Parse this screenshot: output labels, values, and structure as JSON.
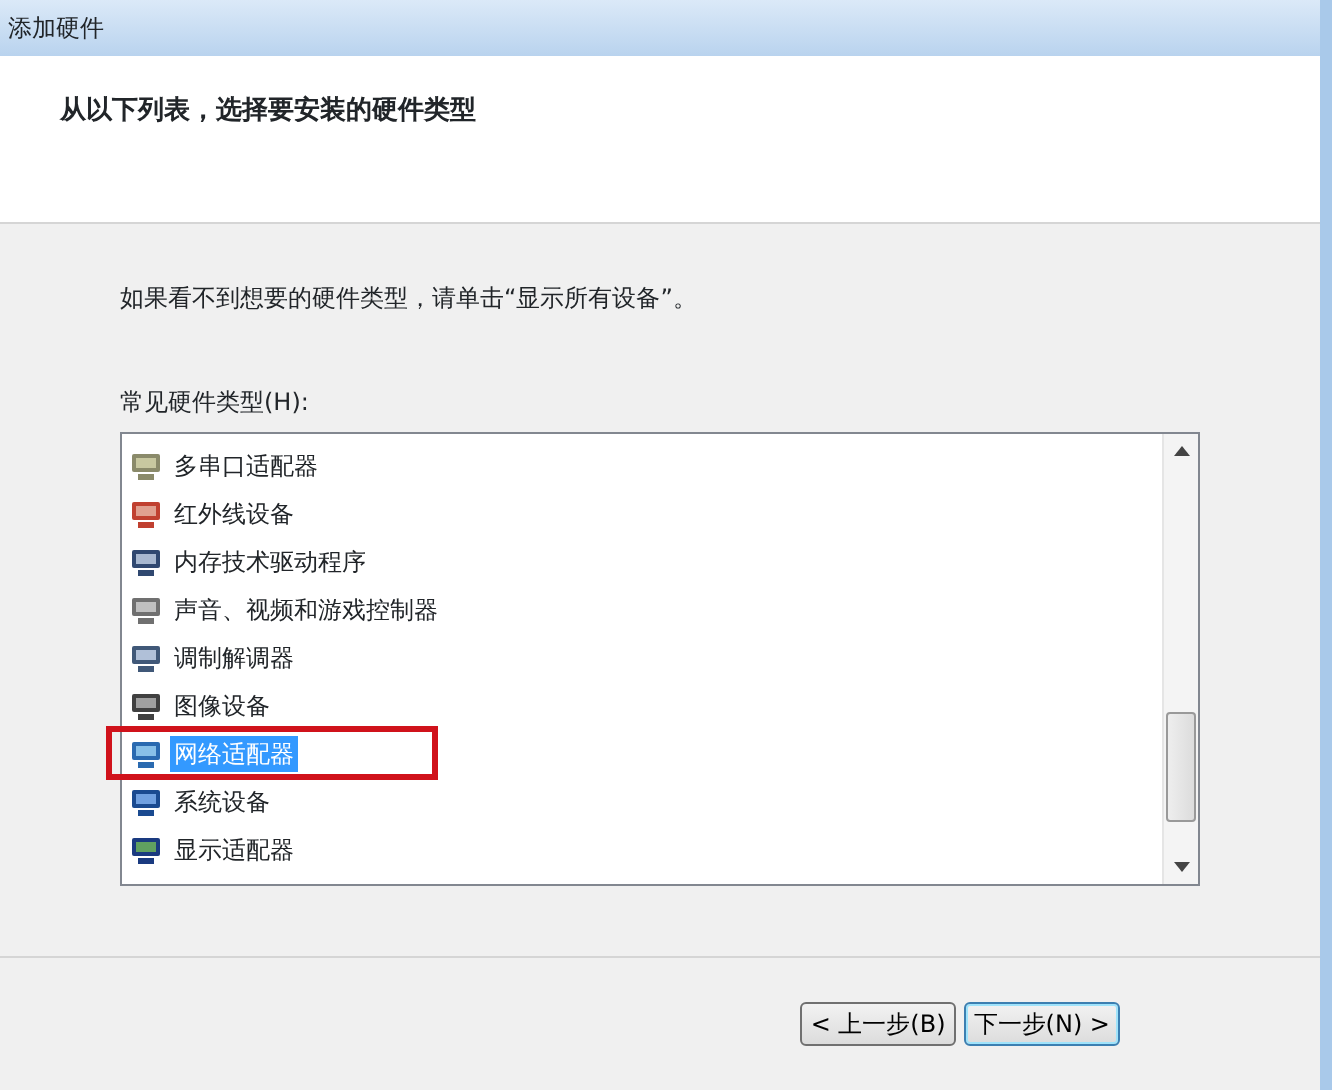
{
  "window": {
    "title": "添加硬件"
  },
  "header": {
    "title": "从以下列表，选择要安装的硬件类型"
  },
  "instruction": "如果看不到想要的硬件类型，请单击“显示所有设备”。",
  "list_label": "常见硬件类型(H):",
  "items": [
    {
      "label": "多串口适配器",
      "selected": false
    },
    {
      "label": "红外线设备",
      "selected": false
    },
    {
      "label": "内存技术驱动程序",
      "selected": false
    },
    {
      "label": "声音、视频和游戏控制器",
      "selected": false
    },
    {
      "label": "调制解调器",
      "selected": false
    },
    {
      "label": "图像设备",
      "selected": false
    },
    {
      "label": "网络适配器",
      "selected": true
    },
    {
      "label": "系统设备",
      "selected": false
    },
    {
      "label": "显示适配器",
      "selected": false
    }
  ],
  "buttons": [
    {
      "label": "< 上一步(B)",
      "default": false
    },
    {
      "label": "下一步(N) >",
      "default": true
    }
  ]
}
